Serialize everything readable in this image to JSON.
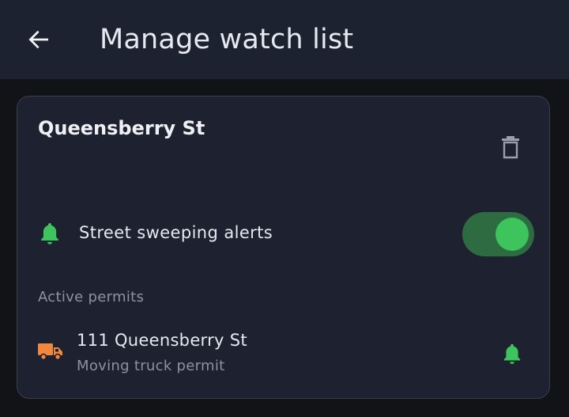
{
  "colors": {
    "app_bar_bg": "#1d2230",
    "page_bg": "#111317",
    "card_bg": "#1d2130",
    "accent_green": "#3dc45d",
    "toggle_track": "#2e6b41",
    "truck_orange": "#f0883e",
    "muted_text": "#8b93a3"
  },
  "header": {
    "back_icon": "arrow-left-icon",
    "title": "Manage watch list"
  },
  "card": {
    "street_name": "Queensberry St",
    "delete_icon": "trash-icon",
    "street_sweeping": {
      "icon": "bell-icon",
      "label": "Street sweeping alerts",
      "enabled": true
    },
    "permits_section_label": "Active permits",
    "permits": [
      {
        "icon": "truck-icon",
        "address": "111 Queensberry St",
        "type": "Moving truck permit",
        "alert_icon": "bell-icon"
      }
    ]
  }
}
